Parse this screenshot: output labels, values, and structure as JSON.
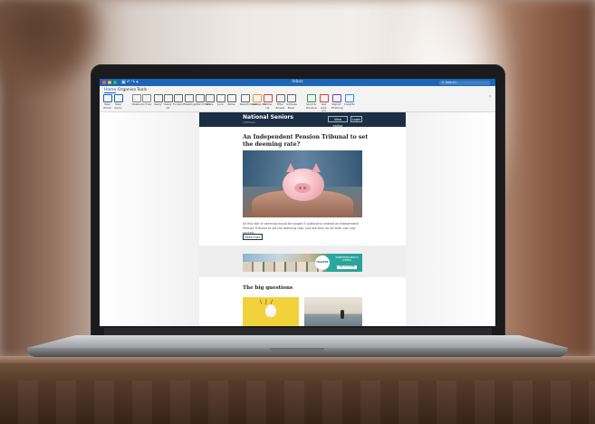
{
  "window": {
    "title": "Inbox",
    "search_placeholder": "Search"
  },
  "ribbon": {
    "tabs": [
      "Home",
      "Organise",
      "Tools"
    ],
    "active_tab": "Home",
    "buttons": [
      {
        "label": "New Email",
        "icon": "new-email-icon",
        "color": "#1b66b8"
      },
      {
        "label": "New Items",
        "icon": "new-items-icon",
        "color": "#1b66b8"
      },
      {
        "label": "Delete",
        "icon": "delete-icon",
        "color": "#888888"
      },
      {
        "label": "Archive",
        "icon": "archive-icon",
        "color": "#888888"
      },
      {
        "label": "Reply",
        "icon": "reply-icon",
        "color": "#666666"
      },
      {
        "label": "Reply All",
        "icon": "reply-all-icon",
        "color": "#666666"
      },
      {
        "label": "Forward",
        "icon": "forward-icon",
        "color": "#666666"
      },
      {
        "label": "Meeting",
        "icon": "meeting-icon",
        "color": "#666666"
      },
      {
        "label": "Attachment",
        "icon": "attachment-icon",
        "color": "#666666"
      },
      {
        "label": "Move",
        "icon": "move-icon",
        "color": "#666666"
      },
      {
        "label": "Junk",
        "icon": "junk-icon",
        "color": "#666666"
      },
      {
        "label": "Rules",
        "icon": "rules-icon",
        "color": "#666666"
      },
      {
        "label": "Read/Unread",
        "icon": "read-unread-icon",
        "color": "#666666"
      },
      {
        "label": "Categorise",
        "icon": "categorise-icon",
        "color": "#d9a42b"
      },
      {
        "label": "Follow Up",
        "icon": "flag-icon",
        "color": "#d83b3b"
      },
      {
        "label": "Filter Emails",
        "icon": "filter-icon",
        "color": "#666666"
      },
      {
        "label": "Address Book",
        "icon": "address-book-icon",
        "color": "#666666"
      },
      {
        "label": "Send & Receive",
        "icon": "send-receive-icon",
        "color": "#2e9a52"
      },
      {
        "label": "Get Add-ins",
        "icon": "add-ins-icon",
        "color": "#d83b3b"
      },
      {
        "label": "Report Phishing",
        "icon": "report-icon",
        "color": "#7b3fb8"
      },
      {
        "label": "Insights",
        "icon": "insights-icon",
        "color": "#2a8fd6"
      }
    ]
  },
  "email": {
    "brand_name": "National Seniors",
    "brand_sub": "AUSTRALIA",
    "header_buttons": [
      "View online",
      "Login"
    ],
    "headline": "An Independent Pension Tribunal to set the deeming rate?",
    "body": "All this talk of deeming would be sought if politicians created an Independent Pension Tribunal to set the deeming rate, just like they do for their own pay packets.",
    "read_more": "Read more",
    "ad": {
      "logo": "HALVERS",
      "headline": "SOMETHING NEW IS COMING",
      "cta": "FIND OUT MORE"
    },
    "section_title": "The big questions"
  },
  "colors": {
    "accent": "#1b66b8",
    "email_header": "#1b2e44"
  }
}
